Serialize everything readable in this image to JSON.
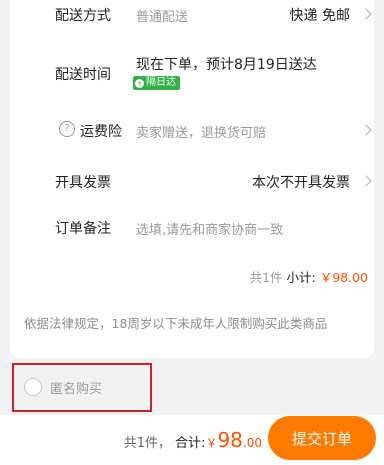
{
  "delivery": {
    "method_label": "配送方式",
    "method_value": "普通配送",
    "method_option": "快递 免邮",
    "time_label": "配送时间",
    "time_value": "现在下单，预计8月19日送达",
    "badge_icon": "bolt-icon",
    "badge_text": "隔日达"
  },
  "shipping_insurance": {
    "icon": "?",
    "label": "运费险",
    "value": "卖家赠送，退换货可赔"
  },
  "invoice": {
    "label": "开具发票",
    "value": "本次不开具发票"
  },
  "remark": {
    "label": "订单备注",
    "placeholder": "选填,请先和商家协商一致"
  },
  "summary": {
    "count_text": "共1件",
    "subtotal_label": "小计:",
    "subtotal_value": "￥98.00"
  },
  "legal_notice": "依据法律规定，18周岁以下未成年人限制购买此类商品",
  "anonymous": {
    "label": "匿名购买",
    "checked": false
  },
  "footer": {
    "count_text": "共1件，",
    "total_label": "合计:",
    "currency": "￥",
    "total_int": "98",
    "total_dec": ".00",
    "submit_label": "提交订单"
  },
  "colors": {
    "accent": "#ff5000",
    "button": "#ff7a00",
    "badge": "#34b24a",
    "highlight_box": "#c8232c"
  }
}
